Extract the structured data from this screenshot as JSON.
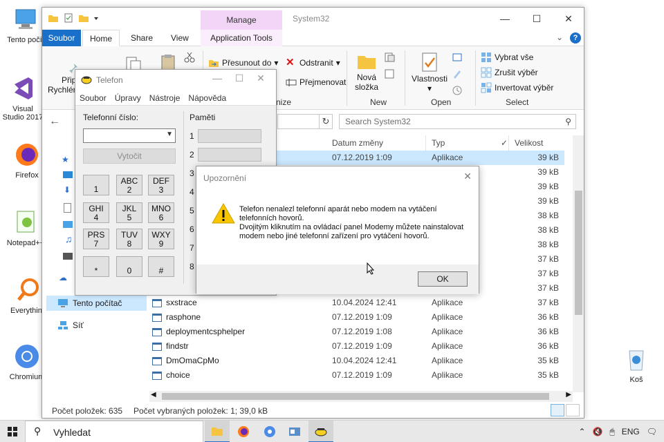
{
  "desktop": {
    "icons": [
      {
        "label": "Tento počít"
      },
      {
        "label": "Visual Studio 2017"
      },
      {
        "label": "Firefox"
      },
      {
        "label": "Notepad++"
      },
      {
        "label": "Everything"
      },
      {
        "label": "Chromium"
      },
      {
        "label": "Koš"
      }
    ]
  },
  "explorer": {
    "title": "System32",
    "manage_tab": "Manage",
    "tabs": {
      "file": "Soubor",
      "home": "Home",
      "share": "Share",
      "view": "View",
      "app_tools": "Application Tools"
    },
    "ribbon": {
      "pin_label": "Připnout",
      "quick_label": "Rychlém",
      "move_to": "Přesunout do",
      "delete": "Odstranit",
      "rename": "Přejmenovat",
      "organize_group": "nize",
      "new_folder_line1": "Nová",
      "new_folder_line2": "složka",
      "new_group": "New",
      "properties": "Vlastnosti",
      "open_group": "Open",
      "select_all": "Vybrat vše",
      "select_none": "Zrušit výběr",
      "invert_selection": "Invertovat výběr",
      "select_group": "Select"
    },
    "search_placeholder": "Search System32",
    "columns": {
      "date": "Datum změny",
      "type": "Typ",
      "size": "Velikost"
    },
    "nav": {
      "this_pc": "Tento počítač",
      "network": "Síť"
    },
    "partial_rows": [
      {
        "date": "07.12.2019 1:09",
        "type": "Aplikace",
        "size": "39 kB"
      },
      {
        "size": "39 kB"
      },
      {
        "size": "39 kB"
      },
      {
        "size": "39 kB"
      },
      {
        "size": "38 kB"
      },
      {
        "size": "38 kB"
      },
      {
        "size": "38 kB"
      },
      {
        "size": "37 kB"
      },
      {
        "size": "37 kB"
      },
      {
        "size": "37 kB"
      }
    ],
    "rows": [
      {
        "name": "sxstrace",
        "date": "10.04.2024 12:41",
        "type": "Aplikace",
        "size": "37 kB"
      },
      {
        "name": "rasphone",
        "date": "07.12.2019 1:09",
        "type": "Aplikace",
        "size": "36 kB"
      },
      {
        "name": "deploymentcsphelper",
        "date": "07.12.2019 1:08",
        "type": "Aplikace",
        "size": "36 kB"
      },
      {
        "name": "findstr",
        "date": "07.12.2019 1:09",
        "type": "Aplikace",
        "size": "36 kB"
      },
      {
        "name": "DmOmaCpMo",
        "date": "10.04.2024 12:41",
        "type": "Aplikace",
        "size": "35 kB"
      },
      {
        "name": "choice",
        "date": "07.12.2019 1:09",
        "type": "Aplikace",
        "size": "35 kB"
      }
    ],
    "status_items": "Počet položek: 635",
    "status_selected": "Počet vybraných položek: 1; 39,0 kB"
  },
  "dialer": {
    "title": "Telefon",
    "menu": [
      "Soubor",
      "Úpravy",
      "Nástroje",
      "Nápověda"
    ],
    "phone_label": "Telefonní číslo:",
    "dial_button": "Vytočit",
    "memory_label": "Paměti",
    "memory_slots": [
      "1",
      "2",
      "3",
      "4",
      "5",
      "6",
      "7",
      "8"
    ],
    "keys": [
      {
        "l1": "",
        "l2": "1"
      },
      {
        "l1": "ABC",
        "l2": "2"
      },
      {
        "l1": "DEF",
        "l2": "3"
      },
      {
        "l1": "GHI",
        "l2": "4"
      },
      {
        "l1": "JKL",
        "l2": "5"
      },
      {
        "l1": "MNO",
        "l2": "6"
      },
      {
        "l1": "PRS",
        "l2": "7"
      },
      {
        "l1": "TUV",
        "l2": "8"
      },
      {
        "l1": "WXY",
        "l2": "9"
      },
      {
        "l1": "",
        "l2": "*"
      },
      {
        "l1": "",
        "l2": "0"
      },
      {
        "l1": "",
        "l2": "#"
      }
    ]
  },
  "alert": {
    "title": "Upozornění",
    "line1": "Telefon nenalezl telefonní aparát nebo modem na vytáčení telefonních hovorů.",
    "line2": "Dvojitým kliknutím na ovládací panel Modemy můžete nainstalovat modem nebo jiné telefonní zařízení pro vytáčení hovorů.",
    "ok": "OK"
  },
  "taskbar": {
    "search": "Vyhledat",
    "lang": "ENG"
  },
  "colors": {
    "accent": "#1a6fc9",
    "selection": "#cce8ff",
    "manage": "#f3d6f7",
    "warning": "#f7c600"
  }
}
